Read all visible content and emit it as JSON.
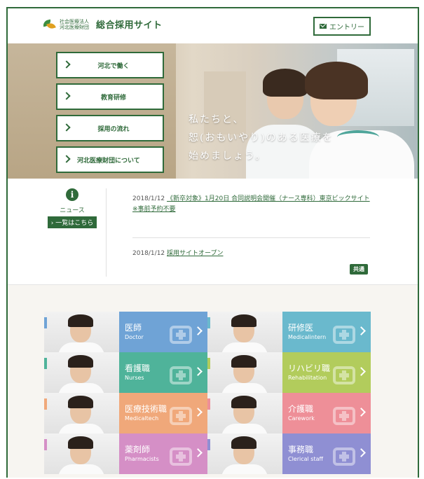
{
  "header": {
    "logo_sub": [
      "社会医療法人",
      "河北医療財団"
    ],
    "site_title": "総合採用サイト",
    "entry_label": "エントリー"
  },
  "hero": {
    "nav": [
      {
        "label": "河北で働く"
      },
      {
        "label": "教育研修"
      },
      {
        "label": "採用の流れ"
      },
      {
        "label": "河北医療財団について"
      }
    ],
    "catch": [
      "私たちと、",
      "恕(おもいやり)のある医療を",
      "始めましょう。"
    ]
  },
  "news": {
    "label": "ニュース",
    "list_link": "一覧はこちら",
    "items": [
      {
        "date": "2018/1/12",
        "title": "《新卒対象》1月20日 合同説明会開催（ナース専科）東京ビックサイト ※事前予約不要"
      },
      {
        "date": "2018/1/12",
        "title": "採用サイトオープン",
        "badge": "共通"
      }
    ]
  },
  "jobs": [
    {
      "jp": "医師",
      "en": "Doctor",
      "color": "#6fa3d6",
      "tab": "#6fa3d6"
    },
    {
      "jp": "研修医",
      "en": "Medicalintern",
      "color": "#6ab9cd",
      "tab": "#6ab9cd"
    },
    {
      "jp": "看護職",
      "en": "Nurses",
      "color": "#4fb39a",
      "tab": "#4fb39a"
    },
    {
      "jp": "リハビリ職",
      "en": "Rehabilitation",
      "color": "#b2cc5c",
      "tab": "#b2cc5c"
    },
    {
      "jp": "医療技術職",
      "en": "Medicaltech",
      "color": "#f0a87a",
      "tab": "#f0a87a"
    },
    {
      "jp": "介護職",
      "en": "Carework",
      "color": "#ee8f98",
      "tab": "#ee8f98"
    },
    {
      "jp": "薬剤師",
      "en": "Pharmacists",
      "color": "#d58fc6",
      "tab": "#d58fc6"
    },
    {
      "jp": "事務職",
      "en": "Clerical staff",
      "color": "#8f8fd3",
      "tab": "#8f8fd3"
    }
  ]
}
